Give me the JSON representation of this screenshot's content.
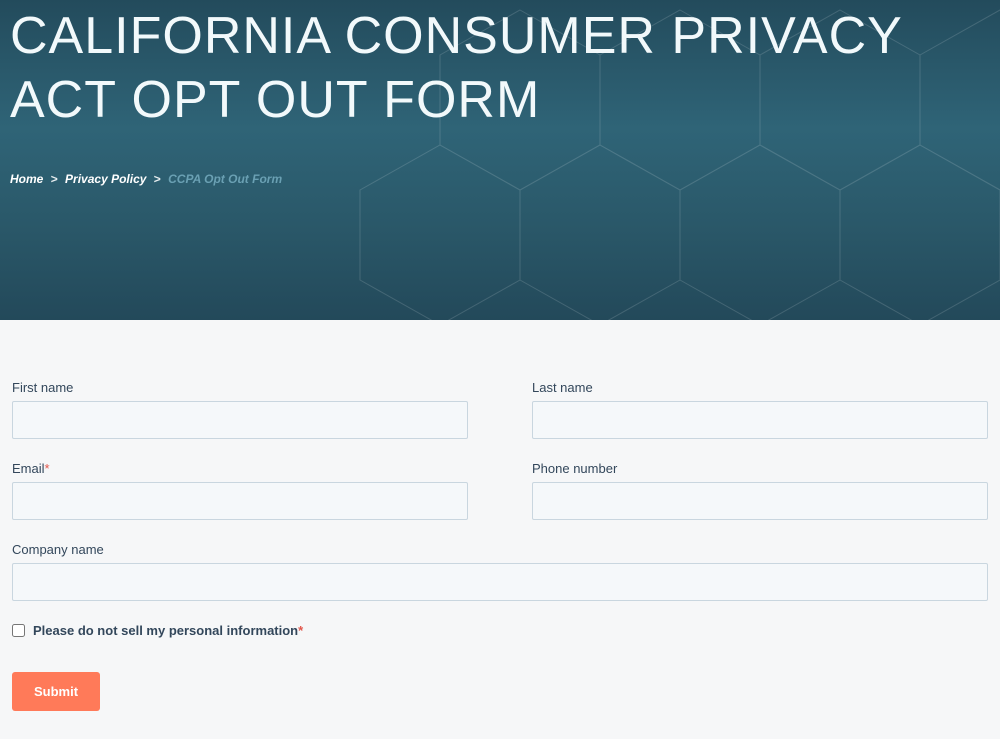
{
  "hero": {
    "title": "CALIFORNIA CONSUMER PRIVACY ACT OPT OUT FORM"
  },
  "breadcrumb": {
    "items": [
      {
        "label": "Home"
      },
      {
        "label": "Privacy Policy"
      },
      {
        "label": "CCPA Opt Out Form",
        "current": true
      }
    ],
    "separator": ">"
  },
  "form": {
    "first_name": {
      "label": "First name",
      "value": "",
      "required": false
    },
    "last_name": {
      "label": "Last name",
      "value": "",
      "required": false
    },
    "email": {
      "label": "Email",
      "value": "",
      "required": true
    },
    "phone": {
      "label": "Phone number",
      "value": "",
      "required": false
    },
    "company": {
      "label": "Company name",
      "value": "",
      "required": false
    },
    "do_not_sell": {
      "label": "Please do not sell my personal information",
      "checked": false,
      "required": true
    },
    "submit_label": "Submit",
    "required_marker": "*"
  }
}
